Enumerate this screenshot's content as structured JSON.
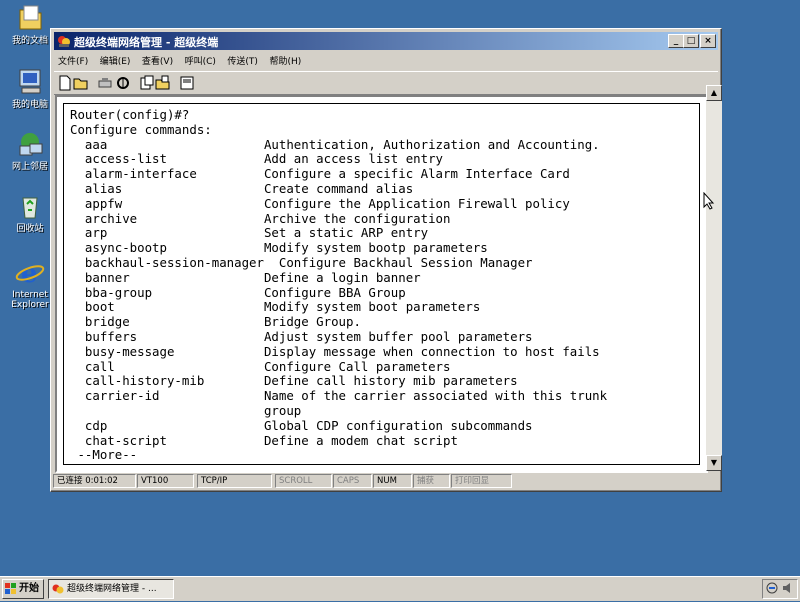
{
  "desktop": {
    "icons": [
      {
        "label": "我的文档",
        "icon": "my-documents-icon"
      },
      {
        "label": "我的电脑",
        "icon": "my-computer-icon"
      },
      {
        "label": "网上邻居",
        "icon": "network-places-icon"
      },
      {
        "label": "回收站",
        "icon": "recycle-bin-icon"
      },
      {
        "label": "Internet Explorer",
        "icon": "internet-explorer-icon"
      }
    ]
  },
  "window": {
    "title": "超级终端网络管理 - 超级终端",
    "controls": {
      "minimize": "_",
      "maximize": "□",
      "close": "×"
    },
    "menus": [
      "文件(F)",
      "编辑(E)",
      "查看(V)",
      "呼叫(C)",
      "传送(T)",
      "帮助(H)"
    ],
    "toolbar": [
      "new-icon",
      "open-icon",
      "disconnect-icon",
      "properties-icon",
      "send-icon",
      "receive-icon",
      "settings-icon"
    ]
  },
  "terminal": {
    "lines": [
      "Router(config)#?",
      "Configure commands:",
      "  aaa                     Authentication, Authorization and Accounting.",
      "  access-list             Add an access list entry",
      "  alarm-interface         Configure a specific Alarm Interface Card",
      "  alias                   Create command alias",
      "  appfw                   Configure the Application Firewall policy",
      "  archive                 Archive the configuration",
      "  arp                     Set a static ARP entry",
      "  async-bootp             Modify system bootp parameters",
      "  backhaul-session-manager  Configure Backhaul Session Manager",
      "  banner                  Define a login banner",
      "  bba-group               Configure BBA Group",
      "  boot                    Modify system boot parameters",
      "  bridge                  Bridge Group.",
      "  buffers                 Adjust system buffer pool parameters",
      "  busy-message            Display message when connection to host fails",
      "  call                    Configure Call parameters",
      "  call-history-mib        Define call history mib parameters",
      "  carrier-id              Name of the carrier associated with this trunk",
      "                          group",
      "  cdp                     Global CDP configuration subcommands",
      "  chat-script             Define a modem chat script",
      " --More--"
    ]
  },
  "status": {
    "connected": "已连接 0:01:02",
    "emulation": "VT100",
    "protocol": "TCP/IP",
    "scroll": "SCROLL",
    "caps": "CAPS",
    "num": "NUM",
    "capture": "捕获",
    "print_echo": "打印回显"
  },
  "taskbar": {
    "start_label": "开始",
    "task_label": "超级终端网络管理 - ..."
  }
}
